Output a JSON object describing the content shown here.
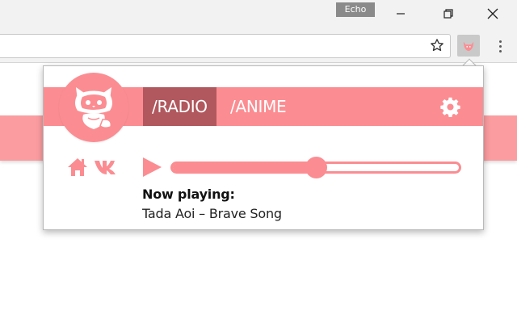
{
  "browser": {
    "profile_name": "Echo",
    "window_controls": {
      "minimize_icon": "minimize-icon",
      "restore_icon": "restore-icon",
      "close_icon": "close-icon"
    },
    "address_bar": {
      "value": "",
      "placeholder": ""
    },
    "bookmark_icon": "star-icon",
    "extension_icon": "fox-icon",
    "menu_icon": "more-vertical-icon"
  },
  "colors": {
    "accent": "#fb8d92",
    "active_tab": "#b1585e",
    "page_banner": "#fb9da0"
  },
  "popup": {
    "logo_icon": "fox-logo-icon",
    "tabs": [
      {
        "label": "/RADIO",
        "active": true
      },
      {
        "label": "/ANIME",
        "active": false
      }
    ],
    "settings_icon": "gear-icon",
    "controls": {
      "home_icon": "home-icon",
      "vk_icon": "vk-icon",
      "play_icon": "play-icon"
    },
    "volume": 0.5,
    "now_playing_label": "Now playing:",
    "track": "Tada Aoi – Brave Song"
  }
}
